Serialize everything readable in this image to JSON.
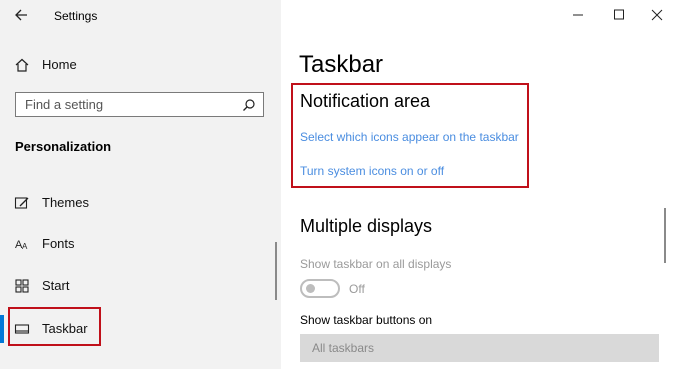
{
  "window": {
    "title": "Settings",
    "controls": {
      "minimize": "minimize-icon",
      "maximize": "maximize-icon",
      "close": "close-icon"
    }
  },
  "sidebar": {
    "home_label": "Home",
    "search_placeholder": "Find a setting",
    "section_title": "Personalization",
    "items": [
      {
        "label": "Themes",
        "icon": "themes-icon"
      },
      {
        "label": "Fonts",
        "icon": "fonts-icon"
      },
      {
        "label": "Start",
        "icon": "start-icon"
      },
      {
        "label": "Taskbar",
        "icon": "taskbar-icon",
        "selected": true
      }
    ]
  },
  "main": {
    "page_title": "Taskbar",
    "notification_area": {
      "heading": "Notification area",
      "links": [
        "Select which icons appear on the taskbar",
        "Turn system icons on or off"
      ]
    },
    "multiple_displays": {
      "heading": "Multiple displays",
      "show_on_all_label": "Show taskbar on all displays",
      "toggle_state": "Off",
      "buttons_on_label": "Show taskbar buttons on",
      "buttons_on_value": "All taskbars"
    }
  },
  "colors": {
    "accent": "#0078d7",
    "link": "#4a8de0",
    "highlight": "#c0101a",
    "sidebar_bg": "#f2f2f2"
  }
}
